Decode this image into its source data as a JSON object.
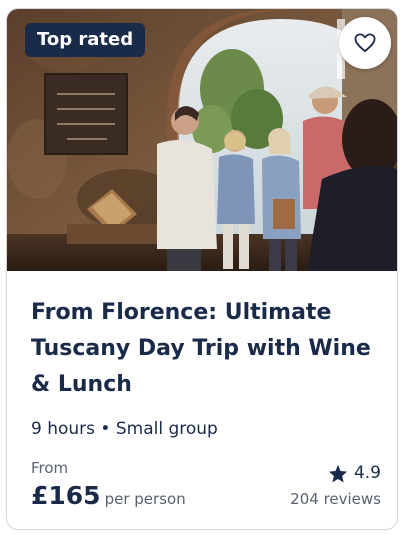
{
  "card": {
    "badge": "Top rated",
    "wishlist_icon": "heart-outline-icon",
    "title": "From Florence: Ultimate Tuscany Day Trip with Wine & Lunch",
    "meta": "9 hours • Small group",
    "from_label": "From",
    "price": "£165",
    "price_unit": "per person",
    "rating_icon": "star-icon",
    "rating": "4.9",
    "reviews": "204 reviews"
  },
  "colors": {
    "primary_text": "#1a2b49",
    "secondary_text": "#5a6272",
    "badge_background": "#1a2b49",
    "card_border": "#d4d6dc"
  }
}
